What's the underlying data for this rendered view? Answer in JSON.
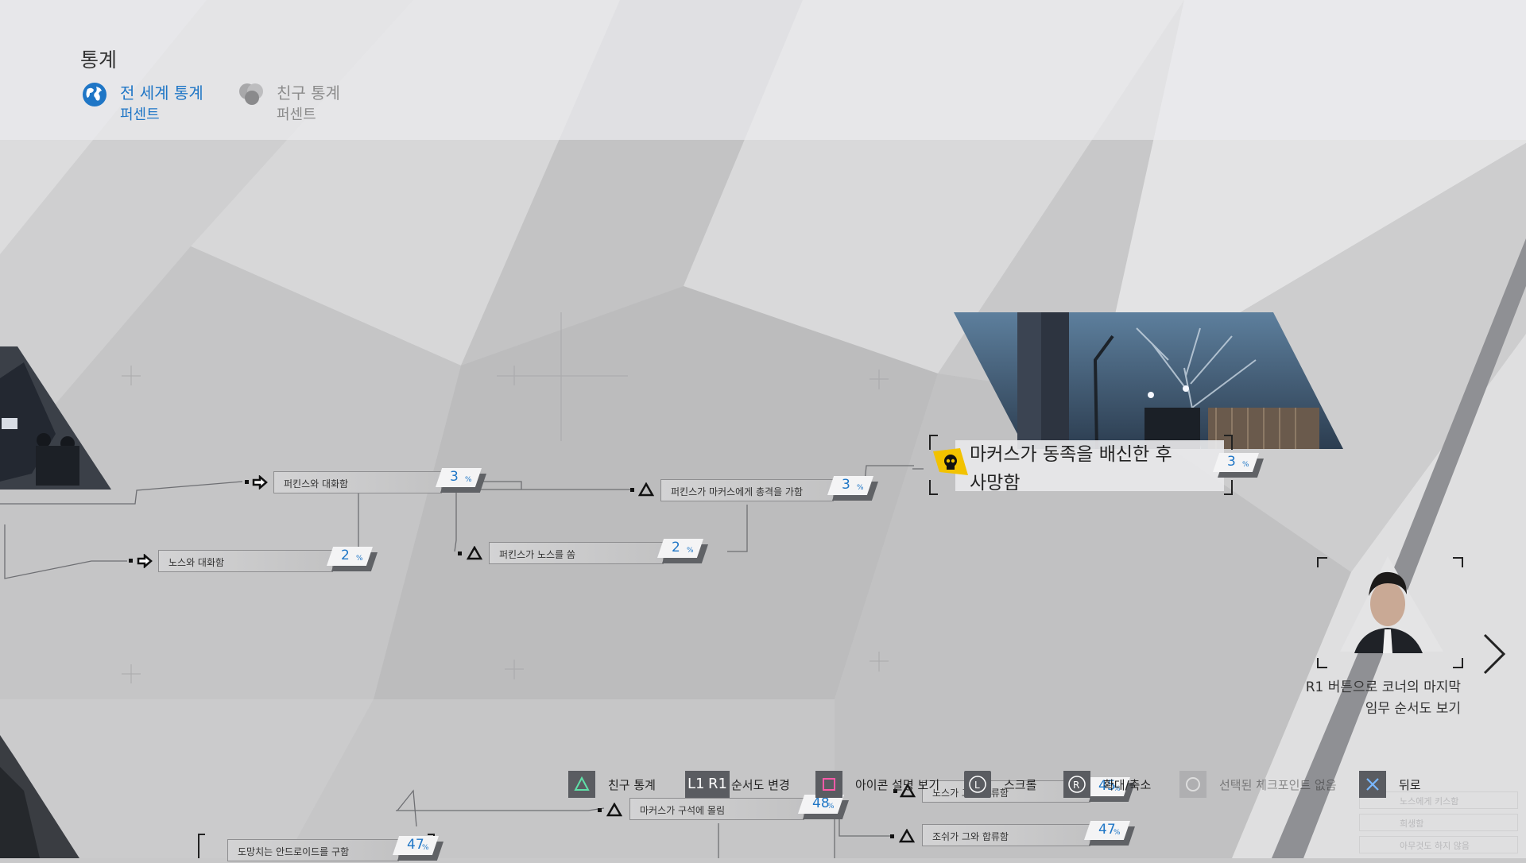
{
  "header": {
    "title": "통계",
    "tabs": [
      {
        "label": "전 세계 통계",
        "sub": "퍼센트",
        "active": true,
        "icon": "globe-icon"
      },
      {
        "label": "친구 통계",
        "sub": "퍼센트",
        "active": false,
        "icon": "friends-icon"
      }
    ]
  },
  "flowchart": {
    "nodes": [
      {
        "label": "퍼킨스와 대화함",
        "percent": "3",
        "unit": "%"
      },
      {
        "label": "노스와 대화함",
        "percent": "2",
        "unit": "%"
      },
      {
        "label": "퍼킨스가 마커스에게 총격을 가함",
        "percent": "3",
        "unit": "%"
      },
      {
        "label": "퍼킨스가 노스를 쏨",
        "percent": "2",
        "unit": "%"
      },
      {
        "label": "마커스가 구석에 몰림",
        "percent": "48",
        "unit": "%"
      },
      {
        "label": "조쉬가 그와 합류함",
        "percent": "47",
        "unit": "%"
      },
      {
        "label": "노스가 그와 합류함",
        "percent": "45",
        "unit": "%"
      },
      {
        "label": "도망치는 안드로이드를 구함",
        "percent": "47",
        "unit": "%"
      }
    ],
    "selected": {
      "line1": "마커스가 동족을 배신한 후",
      "line2": "사망함",
      "percent": "3",
      "unit": "%",
      "icon": "skull-icon"
    },
    "faded_items": [
      "노스에게 키스함",
      "희생함",
      "아무것도 하지 않음"
    ]
  },
  "next_chapter": {
    "line1": "R1 버튼으로 코너의 마지막",
    "line2": "임무 순서도 보기",
    "icon": "chevron-right-icon"
  },
  "bottom_bar": {
    "friends_stats": "친구 통계",
    "l1": "L1",
    "r1": "R1",
    "change_flow": "순서도 변경",
    "icon_desc": "아이콘 설명 보기",
    "scroll_key": "L",
    "scroll": "스크롤",
    "zoom_key": "R",
    "zoom": "확대/축소",
    "no_checkpoint": "선택된 체크포인트 없음",
    "back": "뒤로"
  },
  "colors": {
    "accent": "#1f76c6",
    "skull_badge": "#f2c200",
    "dark_button": "#5a5c61"
  }
}
